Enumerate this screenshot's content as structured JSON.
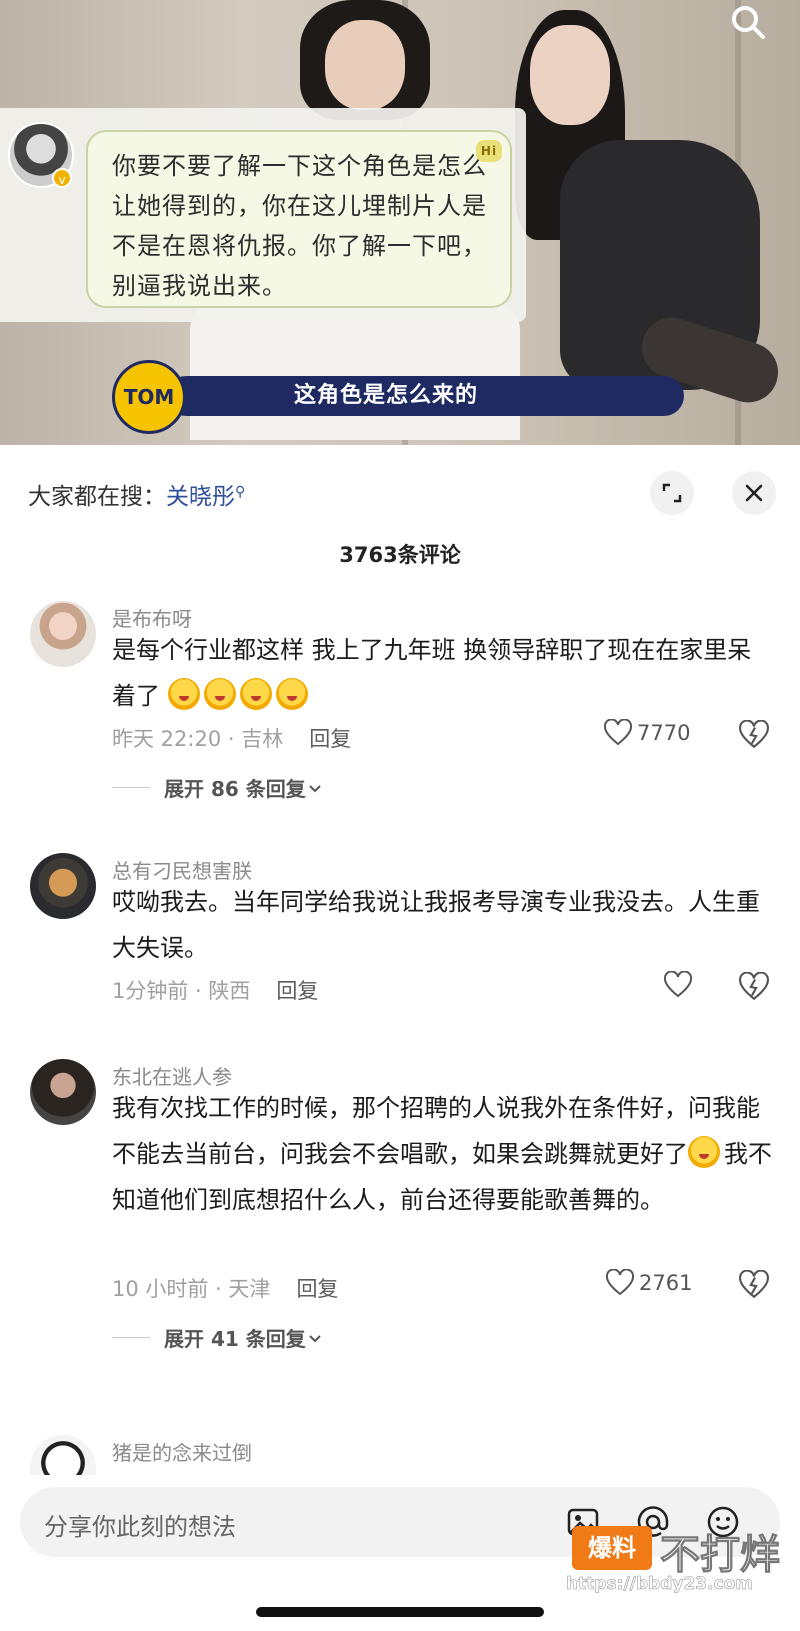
{
  "video": {
    "quote_text": "你要不要了解一下这个角色是怎么让她得到的，你在这儿埋制片人是不是在恩将仇报。你了解一下吧，别逼我说出来。",
    "hi_badge": "Hi",
    "verify_badge": "v",
    "caption_text": "这角色是怎么来的",
    "caption_logo": "TOM"
  },
  "header": {
    "trending_prefix": "大家都在搜：",
    "trending_keyword": "关晓彤",
    "comment_count_title": "3763条评论"
  },
  "comments": [
    {
      "username": "是布布呀",
      "text": "是每个行业都这样 我上了九年班 换领导辞职了现在在家里呆着了",
      "emoji_count": 4,
      "time_location": "昨天 22:20 · 吉林",
      "reply_label": "回复",
      "likes": "7770",
      "expand_label": "展开 86 条回复"
    },
    {
      "username": "总有刁民想害朕",
      "text": "哎呦我去。当年同学给我说让我报考导演专业我没去。人生重大失误。",
      "time_location": "1分钟前 · 陕西",
      "reply_label": "回复",
      "likes": ""
    },
    {
      "username": "东北在逃人参",
      "text_part1": "我有次找工作的时候，那个招聘的人说我外在条件好，问我能不能去当前台，问我会不会唱歌，如果会跳舞就更好了",
      "text_part2": "我不知道他们到底想招什么人，前台还得要能歌善舞的。",
      "time_location": "10 小时前 · 天津",
      "reply_label": "回复",
      "likes": "2761",
      "expand_label": "展开 41 条回复"
    },
    {
      "username": "猪是的念来过倒"
    }
  ],
  "input": {
    "placeholder": "分享你此刻的想法"
  },
  "watermark": {
    "badge": "爆料",
    "text": "不打烊",
    "url": "https://bbdy23.com"
  },
  "colors": {
    "accent_keyword": "#2f4f9a",
    "caption_bar": "#1f2a63",
    "caption_logo": "#f6c300",
    "watermark_badge": "#f07a16"
  }
}
